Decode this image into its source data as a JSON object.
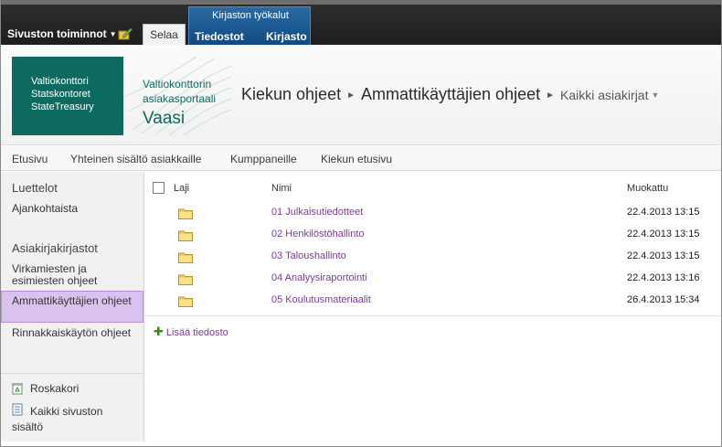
{
  "ribbon": {
    "site_actions": "Sivuston toiminnot",
    "tab_browse": "Selaa",
    "contextual_group": "Kirjaston työkalut",
    "tab_files": "Tiedostot",
    "tab_library": "Kirjasto"
  },
  "header": {
    "logo_lines": [
      "Valtiokonttori",
      "Statskontoret",
      "StateTreasury"
    ],
    "portal_lines": [
      "Valtiokonttorin",
      "asiakasportaali"
    ],
    "portal_city": "Vaasi",
    "breadcrumb": [
      "Kiekun ohjeet",
      "Ammattikäyttäjien ohjeet",
      "Kaikki asiakirjat"
    ]
  },
  "topnav": {
    "items": [
      "Etusivu",
      "Yhteinen sisältö asiakkaille",
      "Kumppaneille",
      "Kiekun etusivu"
    ]
  },
  "leftnav": {
    "heading_lists": "Luettelot",
    "lists": [
      "Ajankohtaista"
    ],
    "heading_libraries": "Asiakirjakirjastot",
    "libraries": [
      "Virkamiesten ja esimiesten ohjeet",
      "Ammattikäyttäjien ohjeet",
      "Rinnakkaiskäytön ohjeet"
    ],
    "recycle_bin": "Roskakori",
    "all_content": "Kaikki sivuston sisältö"
  },
  "list": {
    "columns": {
      "type": "Laji",
      "name": "Nimi",
      "modified": "Muokattu"
    },
    "rows": [
      {
        "name": "01 Julkaisutiedotteet",
        "modified": "22.4.2013 13:15"
      },
      {
        "name": "02 Henkilöstöhallinto",
        "modified": "22.4.2013 13:15"
      },
      {
        "name": "03 Taloushallinto",
        "modified": "22.4.2013 13:15"
      },
      {
        "name": "04 Analyysiraportointi",
        "modified": "22.4.2013 13:16"
      },
      {
        "name": "05 Koulutusmateriaalit",
        "modified": "26.4.2013 15:34"
      }
    ],
    "add_document": "Lisää tiedosto"
  },
  "colors": {
    "brand_green": "#0d6a60",
    "link_purple": "#7b3a96",
    "selected_nav": "#d9c3ee",
    "contextual_blue": "#0f4a82"
  }
}
